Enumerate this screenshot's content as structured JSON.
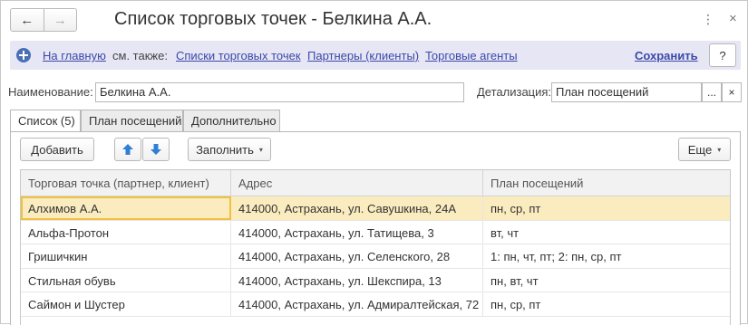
{
  "window": {
    "title": "Список торговых точек - Белкина А.А.",
    "more_glyph": "⋮",
    "close_glyph": "×"
  },
  "nav": {
    "back_glyph": "←",
    "forward_glyph": "→"
  },
  "linkbar": {
    "home": "На главную",
    "see_also": "см. также:",
    "links": [
      "Списки торговых точек",
      "Партнеры (клиенты)",
      "Торговые агенты"
    ],
    "save": "Сохранить",
    "help": "?"
  },
  "form": {
    "name_label": "Наименование:",
    "name_value": "Белкина А.А.",
    "detail_label": "Детализация:",
    "detail_value": "План посещений",
    "select_glyph": "...",
    "clear_glyph": "×"
  },
  "tabs": [
    {
      "label": "Список (5)",
      "active": true
    },
    {
      "label": "План посещений",
      "active": false
    },
    {
      "label": "Дополнительно",
      "active": false
    }
  ],
  "toolbar": {
    "add": "Добавить",
    "fill": "Заполнить",
    "more": "Еще",
    "caret_glyph": "▾"
  },
  "table": {
    "columns": [
      "Торговая точка (партнер, клиент)",
      "Адрес",
      "План посещений"
    ],
    "rows": [
      [
        "Алхимов А.А.",
        "414000, Астрахань, ул. Савушкина, 24А",
        "пн, ср, пт"
      ],
      [
        "Альфа-Протон",
        "414000, Астрахань, ул. Татищева, 3",
        "вт, чт"
      ],
      [
        "Гришичкин",
        "414000, Астрахань, ул. Селенского, 28",
        "1: пн, чт, пт; 2: пн, ср, пт"
      ],
      [
        "Стильная обувь",
        "414000, Астрахань, ул. Шекспира, 13",
        "пн, вт, чт"
      ],
      [
        "Саймон и Шустер",
        "414000, Астрахань, ул. Адмиралтейская, 72",
        "пн, ср, пт"
      ]
    ],
    "selected_row": 0
  },
  "colors": {
    "link": "#3b49a8",
    "linkbar_bg": "#e6e6f5",
    "selected_row": "#fbecc0",
    "arrow_blue": "#2f7fd6"
  }
}
